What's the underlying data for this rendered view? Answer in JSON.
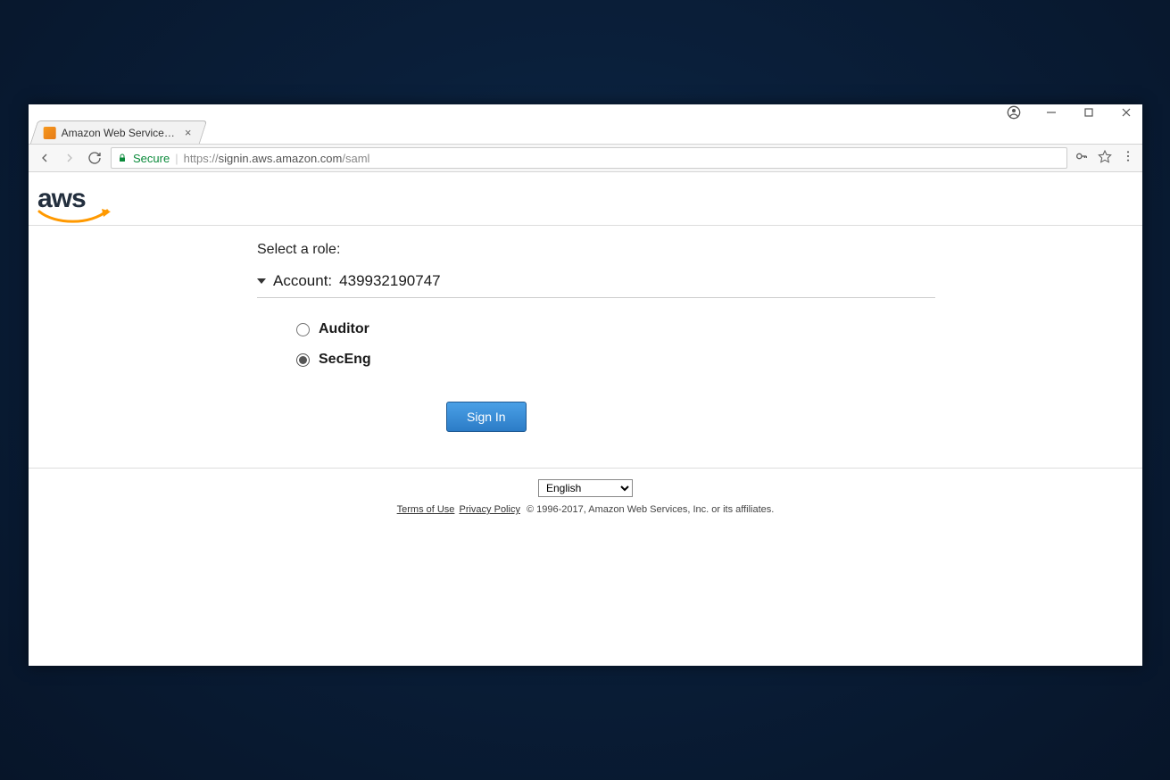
{
  "window": {
    "profile_tooltip": "User profile"
  },
  "browser": {
    "tab_title": "Amazon Web Services Si",
    "secure_label": "Secure",
    "url_scheme": "https://",
    "url_host": "signin.aws.amazon.com",
    "url_path": "/saml"
  },
  "page": {
    "logo_text": "aws",
    "heading": "Select a role:",
    "account_label": "Account:",
    "account_id": "439932190747",
    "roles": [
      {
        "id": "role-auditor",
        "label": "Auditor",
        "selected": false
      },
      {
        "id": "role-seceng",
        "label": "SecEng",
        "selected": true
      }
    ],
    "signin_label": "Sign In"
  },
  "footer": {
    "language_selected": "English",
    "terms_label": "Terms of Use",
    "privacy_label": "Privacy Policy",
    "copyright": "© 1996-2017, Amazon Web Services, Inc. or its affiliates."
  }
}
